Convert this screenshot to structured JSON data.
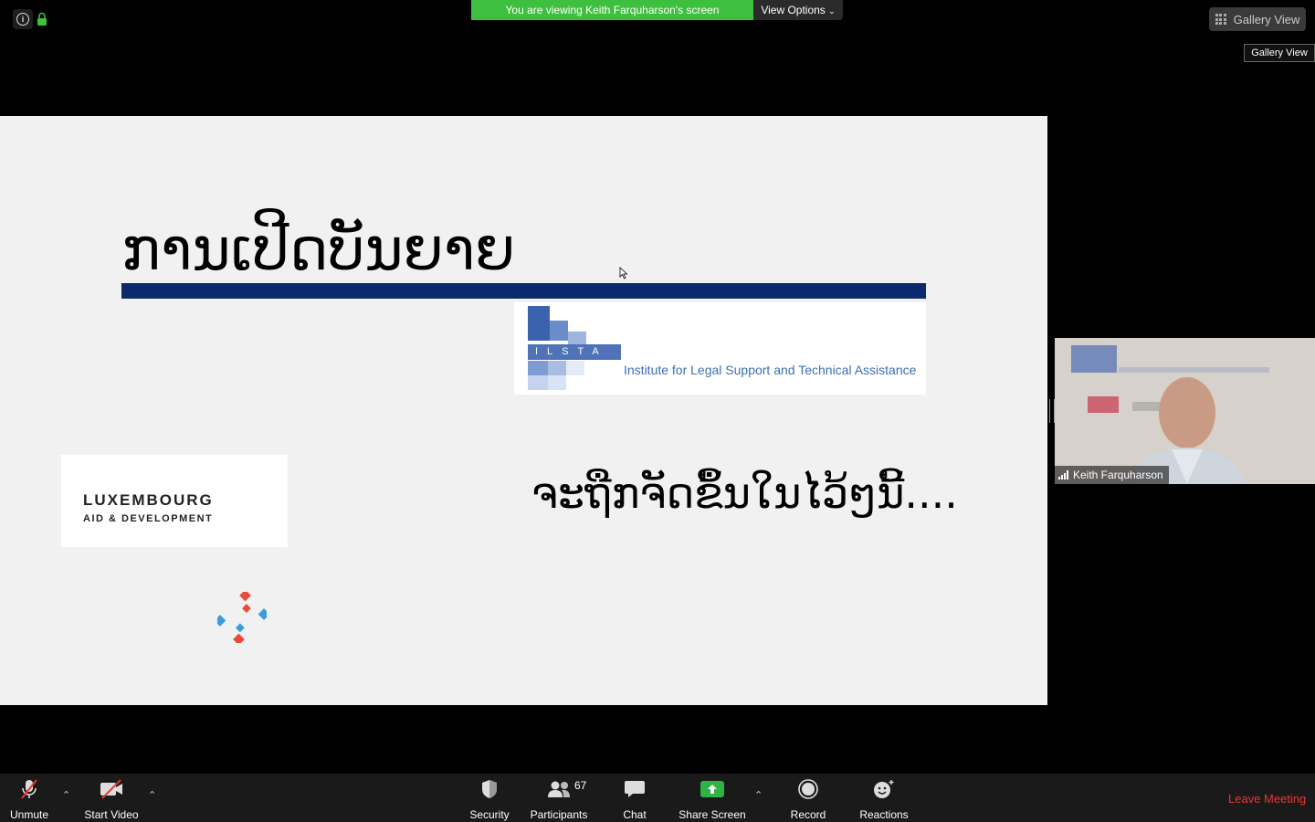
{
  "top_bar": {
    "banner_text": "You are viewing Keith Farquharson's screen",
    "view_options_label": "View Options",
    "gallery_view_label": "Gallery View",
    "gallery_view_tooltip": "Gallery View",
    "banner_color": "#3fbf3f"
  },
  "slide": {
    "title": "ການເປີດບັນຍາຍ",
    "subtitle": "ຈະຖືກຈັດຂຶ້ນໃນໄວ້ໆນີ້....",
    "ilsta_letters": "ILSTA",
    "ilsta_tagline": "Institute for Legal Support and Technical Assistance",
    "lux_line1": "LUXEMBOURG",
    "lux_line2": "AID & DEVELOPMENT",
    "rule_color": "#0c2a6b"
  },
  "participant": {
    "name": "Keith Farquharson"
  },
  "toolbar": {
    "unmute_label": "Unmute",
    "start_video_label": "Start Video",
    "security_label": "Security",
    "participants_label": "Participants",
    "participants_count": "67",
    "chat_label": "Chat",
    "share_screen_label": "Share Screen",
    "record_label": "Record",
    "reactions_label": "Reactions",
    "leave_label": "Leave Meeting",
    "share_color": "#2fb344",
    "leave_color": "#e53935"
  }
}
